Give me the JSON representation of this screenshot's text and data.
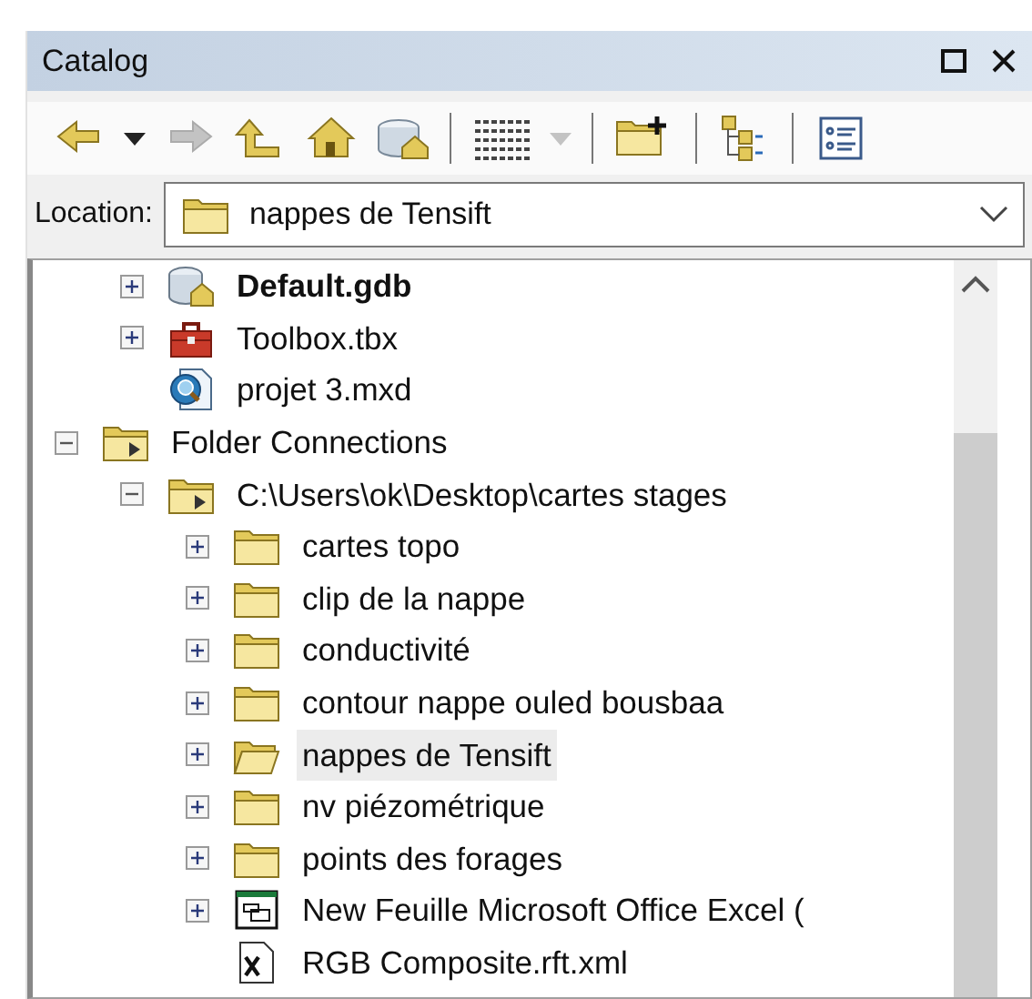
{
  "window": {
    "title": "Catalog",
    "controls": [
      {
        "kind": "maximize"
      },
      {
        "kind": "close"
      }
    ]
  },
  "toolbar": [
    {
      "kind": "back",
      "disabled": false
    },
    {
      "kind": "caret",
      "disabled": false
    },
    {
      "kind": "forward",
      "disabled": true
    },
    {
      "kind": "up",
      "disabled": false
    },
    {
      "kind": "home",
      "disabled": false
    },
    {
      "kind": "home-gdb",
      "disabled": false
    },
    {
      "kind": "separator"
    },
    {
      "kind": "views",
      "disabled": false
    },
    {
      "kind": "caret",
      "disabled": true
    },
    {
      "kind": "separator"
    },
    {
      "kind": "connect-folder",
      "disabled": false
    },
    {
      "kind": "separator"
    },
    {
      "kind": "tree",
      "disabled": false
    },
    {
      "kind": "separator"
    },
    {
      "kind": "details",
      "disabled": false
    }
  ],
  "location": {
    "label": "Location:",
    "value": "nappes de Tensift"
  },
  "tree": {
    "scrolled_branch": [
      {
        "label": "Default.gdb",
        "kind": "gdb",
        "default": true,
        "expanded": false,
        "selected": false
      },
      {
        "label": "Toolbox.tbx",
        "kind": "toolbox",
        "default": false,
        "expanded": false,
        "selected": false
      },
      {
        "label": "projet 3.mxd",
        "kind": "mxd",
        "default": false,
        "selected": false
      }
    ],
    "items": [
      {
        "label": "Folder Connections",
        "kind": "folder-connection",
        "default": false,
        "expanded": true,
        "selected": false,
        "children": [
          {
            "label": "C:\\Users\\ok\\Desktop\\cartes stages",
            "kind": "folder-connection",
            "default": false,
            "expanded": true,
            "selected": false,
            "children": [
              {
                "label": "cartes topo",
                "kind": "folder",
                "default": false,
                "expanded": false,
                "selected": false
              },
              {
                "label": "clip de la nappe",
                "kind": "folder",
                "default": false,
                "expanded": false,
                "selected": false
              },
              {
                "label": "conductivité",
                "kind": "folder",
                "default": false,
                "expanded": false,
                "selected": false
              },
              {
                "label": "contour nappe ouled bousbaa",
                "kind": "folder",
                "default": false,
                "expanded": false,
                "selected": false
              },
              {
                "label": "nappes de Tensift",
                "kind": "open-folder",
                "default": false,
                "expanded": false,
                "selected": true
              },
              {
                "label": "nv piézométrique",
                "kind": "folder",
                "default": false,
                "expanded": false,
                "selected": false
              },
              {
                "label": "points des forages",
                "kind": "folder",
                "default": false,
                "expanded": false,
                "selected": false
              },
              {
                "label": "New Feuille Microsoft Office Excel (",
                "kind": "excel",
                "default": false,
                "expanded": false,
                "selected": false
              },
              {
                "label": "RGB Composite.rft.xml",
                "kind": "xml",
                "default": false,
                "selected": false
              }
            ]
          }
        ]
      }
    ]
  }
}
